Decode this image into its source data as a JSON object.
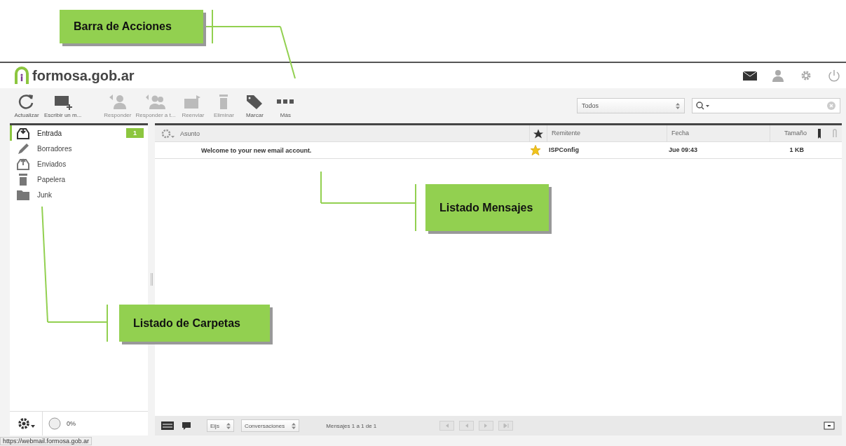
{
  "logo": {
    "text": "formosa.gob.ar"
  },
  "top_nav": [
    {
      "kind": "mail",
      "selected": true
    },
    {
      "kind": "person",
      "selected": false
    },
    {
      "kind": "gear",
      "selected": false
    },
    {
      "kind": "power",
      "selected": false
    }
  ],
  "toolbar": [
    {
      "label": "Actualizar",
      "kind": "refresh",
      "disabled": false
    },
    {
      "label": "Escribir un m...",
      "kind": "compose",
      "disabled": false
    },
    {
      "label": "Responder",
      "kind": "reply",
      "disabled": true
    },
    {
      "label": "Responder a t...",
      "kind": "reply-all",
      "disabled": true
    },
    {
      "label": "Reenviar",
      "kind": "forward",
      "disabled": true
    },
    {
      "label": "Eliminar",
      "kind": "delete",
      "disabled": true
    },
    {
      "label": "Marcar",
      "kind": "tag",
      "disabled": false
    },
    {
      "label": "Más",
      "kind": "more",
      "disabled": false
    }
  ],
  "filter": {
    "value": "Todos"
  },
  "folders": [
    {
      "name": "Entrada",
      "kind": "inbox",
      "selected": true,
      "count": "1"
    },
    {
      "name": "Borradores",
      "kind": "drafts",
      "selected": false
    },
    {
      "name": "Enviados",
      "kind": "sent",
      "selected": false
    },
    {
      "name": "Papelera",
      "kind": "trash",
      "selected": false
    },
    {
      "name": "Junk",
      "kind": "folder",
      "selected": false
    }
  ],
  "quota": {
    "text": "0%"
  },
  "table": {
    "columns": [
      "Asunto",
      "Remitente",
      "Fecha",
      "Tamaño"
    ],
    "rows": [
      {
        "subject": "Welcome to your new email account.",
        "flagged": true,
        "sender": "ISPConfig",
        "date": "Jue 09:43",
        "size": "1 KB"
      }
    ]
  },
  "footer": {
    "threads": "Eijs",
    "view": "Conversaciones",
    "count": "Mensajes 1 a 1 de 1"
  },
  "status_bar": {
    "url": "https://webmail.formosa.gob.ar"
  },
  "annotations": [
    {
      "text": "Barra de Acciones"
    },
    {
      "text": "Listado Mensajes"
    },
    {
      "text": "Listado de Carpetas"
    }
  ]
}
